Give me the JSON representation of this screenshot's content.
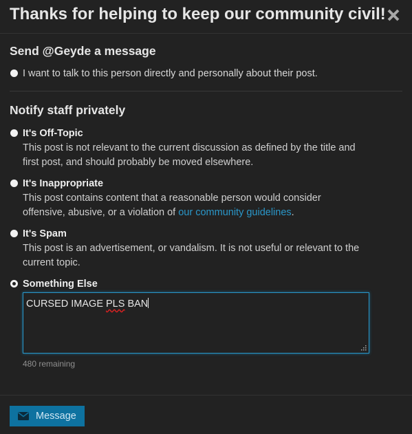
{
  "header": {
    "title": "Thanks for helping to keep our community civil!",
    "close_icon": "close-icon"
  },
  "message_section": {
    "heading": "Send @Geyde a message",
    "option_label": "I want to talk to this person directly and personally about their post."
  },
  "staff_section": {
    "heading": "Notify staff privately",
    "options": [
      {
        "title": "It's Off-Topic",
        "desc_line1": "This post is not relevant to the current discussion as defined by the title and",
        "desc_line2": "first post, and should probably be moved elsewhere."
      },
      {
        "title": "It's Inappropriate",
        "desc_line1": "This post contains content that a reasonable person would consider",
        "desc_line2_prefix": "offensive, abusive, or a violation of ",
        "link": "our community guidelines",
        "desc_line2_suffix": "."
      },
      {
        "title": "It's Spam",
        "desc_line1": "This post is an advertisement, or vandalism. It is not useful or relevant to the",
        "desc_line2": "current topic."
      },
      {
        "title": "Something Else",
        "selected": true
      }
    ],
    "textarea": {
      "value_prefix": "CURSED IMAGE ",
      "value_misspelled": "PLS",
      "value_suffix": " BAN"
    },
    "remaining": "480 remaining"
  },
  "footer": {
    "button_label": "Message",
    "button_icon": "envelope-icon"
  },
  "colors": {
    "background": "#222222",
    "accent": "#0e72a0",
    "link": "#2a97c9"
  }
}
